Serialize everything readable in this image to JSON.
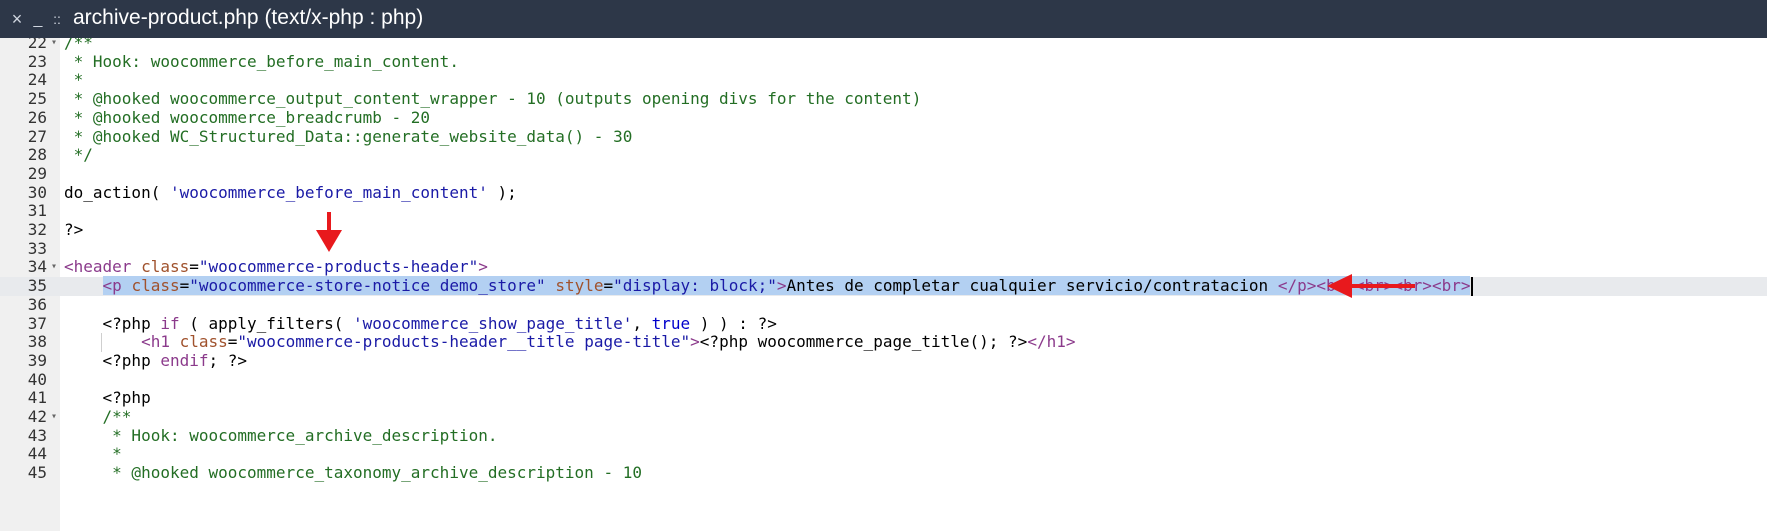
{
  "titlebar": {
    "close_glyph": "×",
    "minimize_glyph": "_",
    "grip_glyph": "::",
    "title": "archive-product.php (text/x-php : php)"
  },
  "editor": {
    "language": "php",
    "active_line": 35,
    "lines": [
      {
        "n": "22",
        "fold": true,
        "tokens": [
          {
            "t": "/**",
            "c": "com"
          }
        ]
      },
      {
        "n": "23",
        "tokens": [
          {
            "t": " * Hook: woocommerce_before_main_content.",
            "c": "com"
          }
        ]
      },
      {
        "n": "24",
        "tokens": [
          {
            "t": " *",
            "c": "com"
          }
        ]
      },
      {
        "n": "25",
        "tokens": [
          {
            "t": " * @hooked woocommerce_output_content_wrapper - 10 (outputs opening divs for the content)",
            "c": "com"
          }
        ]
      },
      {
        "n": "26",
        "tokens": [
          {
            "t": " * @hooked woocommerce_breadcrumb - 20",
            "c": "com"
          }
        ]
      },
      {
        "n": "27",
        "tokens": [
          {
            "t": " * @hooked WC_Structured_Data::generate_website_data() - 30",
            "c": "com"
          }
        ]
      },
      {
        "n": "28",
        "tokens": [
          {
            "t": " */",
            "c": "com"
          }
        ]
      },
      {
        "n": "29",
        "tokens": []
      },
      {
        "n": "30",
        "tokens": [
          {
            "t": "do_action( ",
            "c": "plain"
          },
          {
            "t": "'woocommerce_before_main_content'",
            "c": "str"
          },
          {
            "t": " );",
            "c": "plain"
          }
        ]
      },
      {
        "n": "31",
        "tokens": []
      },
      {
        "n": "32",
        "tokens": [
          {
            "t": "?>",
            "c": "plain"
          }
        ]
      },
      {
        "n": "33",
        "tokens": []
      },
      {
        "n": "34",
        "fold": true,
        "tokens": [
          {
            "t": "<header ",
            "c": "tag"
          },
          {
            "t": "class",
            "c": "attr"
          },
          {
            "t": "=",
            "c": "plain"
          },
          {
            "t": "\"woocommerce-products-header\"",
            "c": "str"
          },
          {
            "t": ">",
            "c": "tag"
          }
        ]
      },
      {
        "n": "35",
        "selected": true,
        "tokens": [
          {
            "t": "    ",
            "c": "plain",
            "nosel": true
          },
          {
            "t": "<p ",
            "c": "tag"
          },
          {
            "t": "class",
            "c": "attr"
          },
          {
            "t": "=",
            "c": "plain"
          },
          {
            "t": "\"woocommerce-store-notice demo_store\"",
            "c": "str"
          },
          {
            "t": " ",
            "c": "plain"
          },
          {
            "t": "style",
            "c": "attr"
          },
          {
            "t": "=",
            "c": "plain"
          },
          {
            "t": "\"display: block;\"",
            "c": "str"
          },
          {
            "t": ">",
            "c": "tag"
          },
          {
            "t": "Antes de completar cualquier servicio/contratacion ",
            "c": "plain"
          },
          {
            "t": "</p><br><br><br><br>",
            "c": "tag"
          }
        ]
      },
      {
        "n": "36",
        "tokens": []
      },
      {
        "n": "37",
        "tokens": [
          {
            "t": "    <?php ",
            "c": "plain"
          },
          {
            "t": "if",
            "c": "kw"
          },
          {
            "t": " ( apply_filters( ",
            "c": "plain"
          },
          {
            "t": "'woocommerce_show_page_title'",
            "c": "str"
          },
          {
            "t": ", ",
            "c": "plain"
          },
          {
            "t": "true",
            "c": "bool"
          },
          {
            "t": " ) ) : ?>",
            "c": "plain"
          }
        ]
      },
      {
        "n": "38",
        "guide": true,
        "tokens": [
          {
            "t": "        ",
            "c": "plain"
          },
          {
            "t": "<h1 ",
            "c": "tag"
          },
          {
            "t": "class",
            "c": "attr"
          },
          {
            "t": "=",
            "c": "plain"
          },
          {
            "t": "\"woocommerce-products-header__title page-title\"",
            "c": "str"
          },
          {
            "t": ">",
            "c": "tag"
          },
          {
            "t": "<?php woocommerce_page_title(); ?>",
            "c": "plain"
          },
          {
            "t": "</h1>",
            "c": "tag"
          }
        ]
      },
      {
        "n": "39",
        "tokens": [
          {
            "t": "    <?php ",
            "c": "plain"
          },
          {
            "t": "endif",
            "c": "kw"
          },
          {
            "t": "; ?>",
            "c": "plain"
          }
        ]
      },
      {
        "n": "40",
        "tokens": []
      },
      {
        "n": "41",
        "tokens": [
          {
            "t": "    <?php",
            "c": "plain"
          }
        ]
      },
      {
        "n": "42",
        "fold": true,
        "tokens": [
          {
            "t": "    /**",
            "c": "com"
          }
        ]
      },
      {
        "n": "43",
        "tokens": [
          {
            "t": "     * Hook: woocommerce_archive_description.",
            "c": "com"
          }
        ]
      },
      {
        "n": "44",
        "tokens": [
          {
            "t": "     *",
            "c": "com"
          }
        ]
      },
      {
        "n": "45",
        "tokens": [
          {
            "t": "     * @hooked woocommerce_taxonomy_archive_description - 10",
            "c": "com"
          }
        ]
      }
    ]
  },
  "colors": {
    "titlebar_bg": "#2d3748",
    "selection": "#b3d0f2",
    "active_line": "#e8eaed",
    "annotation_arrow": "#e8191d"
  },
  "annotations": [
    {
      "name": "down-arrow",
      "points_to": "class=\"woocommerce-products-header\" (line 34)"
    },
    {
      "name": "left-arrow",
      "points_to": "end of line 35"
    }
  ]
}
